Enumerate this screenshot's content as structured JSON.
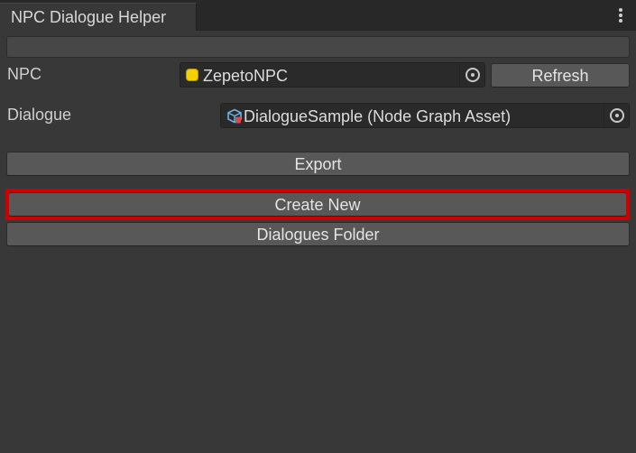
{
  "window": {
    "tab_title": "NPC Dialogue Helper"
  },
  "npc": {
    "label": "NPC",
    "value": "ZepetoNPC",
    "icon": "gameobject-icon",
    "refresh_label": "Refresh"
  },
  "dialogue": {
    "label": "Dialogue",
    "value": "DialogueSample (Node Graph Asset)",
    "icon": "node-graph-asset-icon"
  },
  "actions": {
    "export_label": "Export",
    "create_new_label": "Create New",
    "dialogues_folder_label": "Dialogues Folder"
  },
  "colors": {
    "highlight": "#d00000",
    "npc_icon": "#f5d000"
  }
}
